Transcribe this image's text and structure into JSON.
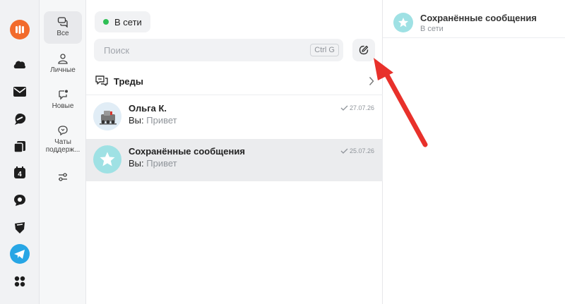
{
  "colors": {
    "accent_orange": "#f26b2c",
    "telegram_blue": "#27a6e5",
    "online_green": "#2fbf55",
    "arrow_red": "#e8312b",
    "avatar_teal": "#9fe1e4"
  },
  "rail": {
    "icons": [
      "app-logo-icon",
      "cloud-icon",
      "mail-icon",
      "messenger-icon",
      "copy-icon",
      "calendar-icon",
      "speech-icon",
      "shield-icon",
      "telegram-icon",
      "apps-grid-icon"
    ],
    "calendar_day": "4"
  },
  "folders": [
    {
      "label": "Все",
      "icon": "chat-bubbles-icon"
    },
    {
      "label": "Личные",
      "icon": "person-icon"
    },
    {
      "label": "Новые",
      "icon": "new-chat-icon"
    },
    {
      "label": "Чаты поддерж...",
      "icon": "support-chat-icon"
    },
    {
      "label": "",
      "icon": "filter-settings-icon"
    }
  ],
  "status": {
    "label": "В сети"
  },
  "search": {
    "placeholder": "Поиск",
    "shortcut": "Ctrl G"
  },
  "threads": {
    "label": "Треды"
  },
  "chats": [
    {
      "name": "Ольга К.",
      "prefix": "Вы:",
      "message": "Привет",
      "date": "27.07.26"
    },
    {
      "name": "Сохранённые сообщения",
      "prefix": "Вы:",
      "message": "Привет",
      "date": "25.07.26"
    }
  ],
  "header": {
    "title": "Сохранённые сообщения",
    "subtitle": "В сети"
  }
}
